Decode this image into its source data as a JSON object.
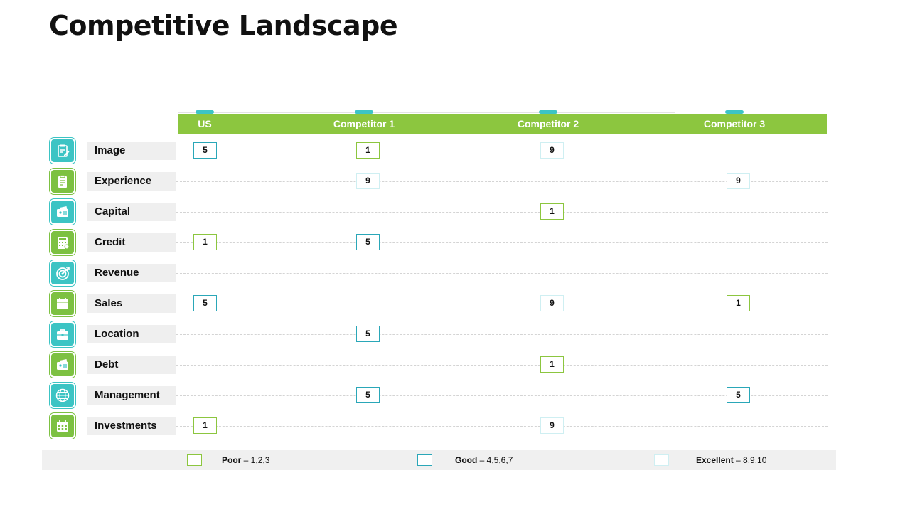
{
  "title": "Competitive Landscape",
  "columns": [
    "US",
    "Competitor 1",
    "Competitor 2",
    "Competitor 3"
  ],
  "colors": {
    "header": "#8cc63f",
    "poor": "#8cc63f",
    "good": "#2aa7b8",
    "excellent": "#cfeff2",
    "icon_teal": "#3cc4c4",
    "icon_green": "#7dc142"
  },
  "rows": [
    {
      "label": "Image",
      "icon": "clipboard-edit-icon",
      "scores": [
        5,
        1,
        9,
        null
      ]
    },
    {
      "label": "Experience",
      "icon": "clipboard-icon",
      "scores": [
        null,
        9,
        null,
        9
      ]
    },
    {
      "label": "Capital",
      "icon": "wallet-card-icon",
      "scores": [
        null,
        null,
        1,
        null
      ]
    },
    {
      "label": "Credit",
      "icon": "calculator-icon",
      "scores": [
        1,
        5,
        null,
        null
      ]
    },
    {
      "label": "Revenue",
      "icon": "target-icon",
      "scores": [
        null,
        null,
        null,
        null
      ]
    },
    {
      "label": "Sales",
      "icon": "calendar-icon",
      "scores": [
        5,
        null,
        9,
        1
      ]
    },
    {
      "label": "Location",
      "icon": "briefcase-icon",
      "scores": [
        null,
        5,
        null,
        null
      ]
    },
    {
      "label": "Debt",
      "icon": "wallet-card-icon",
      "scores": [
        null,
        null,
        1,
        null
      ]
    },
    {
      "label": "Management",
      "icon": "globe-icon",
      "scores": [
        null,
        5,
        null,
        5
      ]
    },
    {
      "label": "Investments",
      "icon": "calendar-grid-icon",
      "scores": [
        1,
        null,
        9,
        null
      ]
    }
  ],
  "legend": [
    {
      "key": "poor",
      "label": "Poor",
      "range": " – 1,2,3"
    },
    {
      "key": "good",
      "label": "Good",
      "range": "  – 4,5,6,7"
    },
    {
      "key": "excellent",
      "label": "Excellent",
      "range": " – 8,9,10"
    }
  ]
}
